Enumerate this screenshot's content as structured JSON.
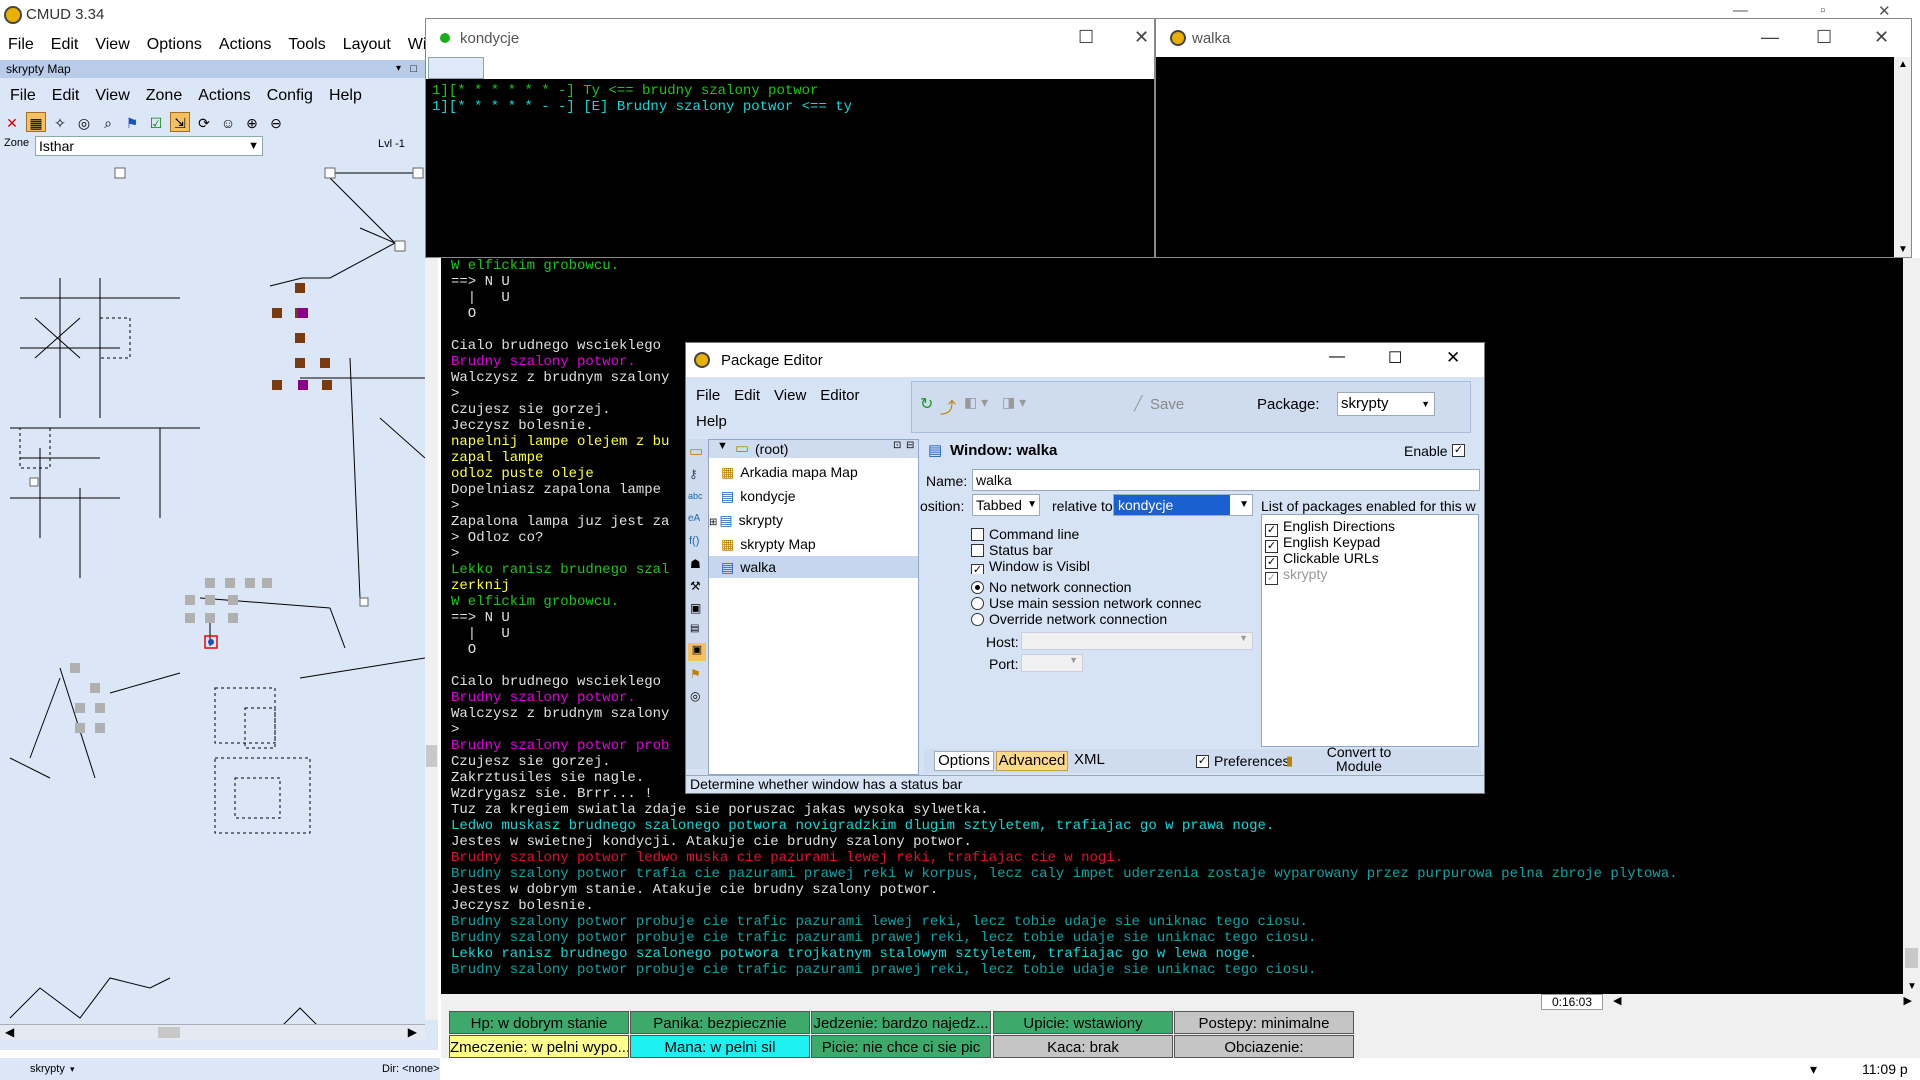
{
  "app": {
    "title": "CMUD 3.34",
    "menu": [
      "File",
      "Edit",
      "View",
      "Options",
      "Actions",
      "Tools",
      "Layout",
      "Windo"
    ]
  },
  "map": {
    "title": "skrypty Map",
    "menu": [
      "File",
      "Edit",
      "View",
      "Zone",
      "Actions",
      "Config",
      "Help"
    ],
    "zone_label": "Zone",
    "zone_value": "Isthar",
    "level": "Lvl -1",
    "package": "skrypty",
    "dir": "Dir: <none>"
  },
  "kondycje": {
    "title": "kondycje",
    "lines": [
      {
        "text": "1][* * * * * * -] Ty <== brudny szalony potwor",
        "color": "g"
      },
      {
        "text": "1][* * * * * - -] [E] Brudny szalony potwor <== ty",
        "color": "c"
      }
    ]
  },
  "walka": {
    "title": "walka"
  },
  "output": [
    {
      "text": "W elfickim grobowcu.",
      "color": "g"
    },
    {
      "text": "==> N U",
      "color": "w"
    },
    {
      "text": "  |   U",
      "color": "w"
    },
    {
      "text": "  O",
      "color": "w"
    },
    {
      "text": "",
      "color": "w"
    },
    {
      "text": "Cialo brudnego wscieklego",
      "color": "w"
    },
    {
      "text": "Brudny szalony potwor.",
      "color": "m"
    },
    {
      "text": "Walczysz z brudnym szalony",
      "color": "w"
    },
    {
      "text": ">",
      "color": "w"
    },
    {
      "text": "Czujesz sie gorzej.",
      "color": "w"
    },
    {
      "text": "Jeczysz bolesnie.",
      "color": "w"
    },
    {
      "text": "napelnij lampe olejem z bu",
      "color": "y"
    },
    {
      "text": "zapal lampe",
      "color": "y"
    },
    {
      "text": "odloz puste oleje",
      "color": "y"
    },
    {
      "text": "Dopelniasz zapalona lampe",
      "color": "w"
    },
    {
      "text": ">",
      "color": "w"
    },
    {
      "text": "Zapalona lampa juz jest za",
      "color": "w"
    },
    {
      "text": "> Odloz co?",
      "color": "w"
    },
    {
      "text": ">",
      "color": "w"
    },
    {
      "text": "Lekko ranisz brudnego szal",
      "color": "g"
    },
    {
      "text": "zerknij",
      "color": "y"
    },
    {
      "text": "W elfickim grobowcu.",
      "color": "g"
    },
    {
      "text": "==> N U",
      "color": "w"
    },
    {
      "text": "  |   U",
      "color": "w"
    },
    {
      "text": "  O",
      "color": "w"
    },
    {
      "text": "",
      "color": "w"
    },
    {
      "text": "Cialo brudnego wscieklego",
      "color": "w"
    },
    {
      "text": "Brudny szalony potwor.",
      "color": "m"
    },
    {
      "text": "Walczysz z brudnym szalony",
      "color": "w"
    },
    {
      "text": ">",
      "color": "w"
    },
    {
      "text": "Brudny szalony potwor prob",
      "color": "m"
    },
    {
      "text": "Czujesz sie gorzej.",
      "color": "w"
    },
    {
      "text": "Zakrztusiles sie nagle.",
      "color": "w"
    },
    {
      "text": "Wzdrygasz sie. Brrr... !",
      "color": "w"
    },
    {
      "text": "Tuz za kregiem swiatla zdaje sie poruszac jakas wysoka sylwetka.",
      "color": "w"
    },
    {
      "text": "Ledwo muskasz brudnego szalonego potwora novigradzkim dlugim sztyletem, trafiajac go w prawa noge.",
      "color": "c"
    },
    {
      "text": "Jestes w swietnej kondycji. Atakuje cie brudny szalony potwor.",
      "color": "w"
    },
    {
      "text": "Brudny szalony potwor ledwo muska cie pazurami lewej reki, trafiajac cie w nogi.",
      "color": "r"
    },
    {
      "text": "Brudny szalony potwor trafia cie pazurami prawej reki w korpus, lecz caly impet uderzenia zostaje wyparowany przez purpurowa pelna zbroje plytowa.",
      "color": "t"
    },
    {
      "text": "Jestes w dobrym stanie. Atakuje cie brudny szalony potwor.",
      "color": "w"
    },
    {
      "text": "Jeczysz bolesnie.",
      "color": "w"
    },
    {
      "text": "Brudny szalony potwor probuje cie trafic pazurami lewej reki, lecz tobie udaje sie uniknac tego ciosu.",
      "color": "t"
    },
    {
      "text": "Brudny szalony potwor probuje cie trafic pazurami prawej reki, lecz tobie udaje sie uniknac tego ciosu.",
      "color": "t"
    },
    {
      "text": "Lekko ranisz brudnego szalonego potwora trojkatnym stalowym sztyletem, trafiajac go w lewa noge.",
      "color": "c"
    },
    {
      "text": "Brudny szalony potwor probuje cie trafic pazurami prawej reki, lecz tobie udaje sie uniknac tego ciosu.",
      "color": "t"
    }
  ],
  "timer": "0:16:03",
  "status": [
    {
      "text": "Hp: w dobrym stanie",
      "style": "sg"
    },
    {
      "text": "Panika: bezpiecznie",
      "style": "sg"
    },
    {
      "text": "Jedzenie: bardzo najedz...",
      "style": "sg"
    },
    {
      "text": "Upicie: wstawiony",
      "style": "sg"
    },
    {
      "text": "Postepy: minimalne",
      "style": "sgr"
    },
    {
      "text": "Zmeczenie: w pelni wypo...",
      "style": "sy"
    },
    {
      "text": "Mana: w pelni sil",
      "style": "sc"
    },
    {
      "text": "Picie: nie chce ci sie pic",
      "style": "sg"
    },
    {
      "text": "Kaca: brak",
      "style": "sgr"
    },
    {
      "text": "Obciazenie:",
      "style": "sgr"
    }
  ],
  "clock": "11:09 p",
  "package_editor": {
    "title": "Package Editor",
    "menu": [
      "File",
      "Edit",
      "View",
      "Editor",
      "Help"
    ],
    "save": "Save",
    "package_label": "Package:",
    "package_value": "skrypty",
    "tree": [
      "(root)",
      "Arkadia mapa Map",
      "kondycje",
      "skrypty",
      "skrypty Map",
      "walka"
    ],
    "header": "Window: walka",
    "enable": "Enable",
    "name_label": "Name:",
    "name_value": "walka",
    "position_label": "osition:",
    "position_value": "Tabbed",
    "relative_label": "relative to",
    "relative_value": "kondycje",
    "checks": [
      {
        "label": "Command line",
        "on": false
      },
      {
        "label": "Status bar",
        "on": false
      },
      {
        "label": "Window is Visibl",
        "on": true
      }
    ],
    "radios": [
      {
        "label": "No network connection",
        "on": true
      },
      {
        "label": "Use main session network connec",
        "on": false
      },
      {
        "label": "Override network connection",
        "on": false
      }
    ],
    "host_label": "Host:",
    "port_label": "Port:",
    "packages_label": "List of packages enabled for this w",
    "packages": [
      {
        "label": "English Directions",
        "on": true,
        "dim": false
      },
      {
        "label": "English Keypad",
        "on": true,
        "dim": false
      },
      {
        "label": "Clickable URLs",
        "on": true,
        "dim": false
      },
      {
        "label": "skrypty",
        "on": true,
        "dim": true
      }
    ],
    "tabs": [
      "Options",
      "Advanced",
      "XML"
    ],
    "preferences": "Preferences",
    "convert": "Convert to Module",
    "statusbar": "Determine whether window has a status bar"
  }
}
